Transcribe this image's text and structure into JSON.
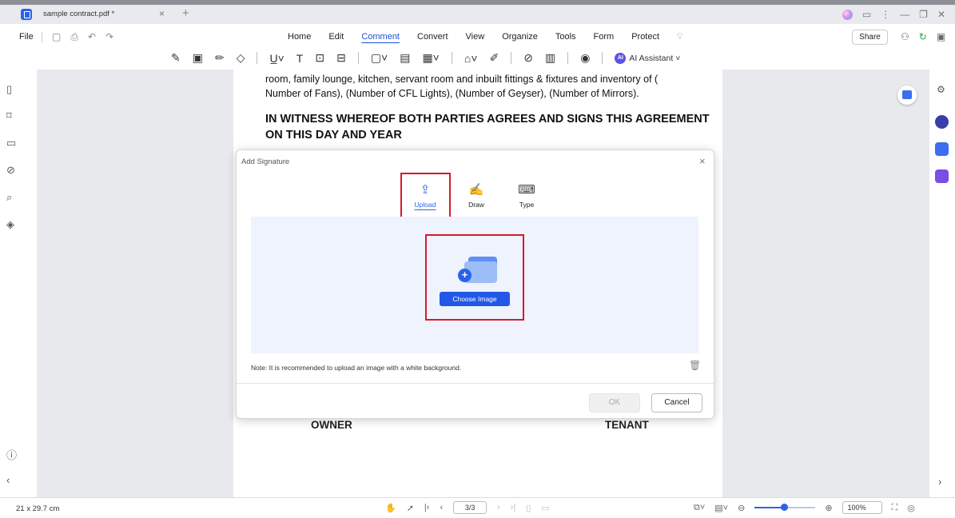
{
  "window": {
    "tab_title": "sample contract.pdf *",
    "tab_close": "×",
    "tab_add": "+",
    "controls": [
      "⋮",
      "—",
      "❐",
      "✕"
    ]
  },
  "menubar": {
    "file": "File",
    "menus": [
      "Home",
      "Edit",
      "Comment",
      "Convert",
      "View",
      "Organize",
      "Tools",
      "Form",
      "Protect"
    ],
    "active_menu": "Comment",
    "share": "Share"
  },
  "toolbar": {
    "ai_badge": "AI",
    "ai_assistant": "AI Assistant ˅"
  },
  "document": {
    "line1": "room, family lounge, kitchen, servant room and inbuilt fittings & fixtures and inventory of (",
    "line2": "Number of Fans), (Number of CFL Lights), (Number of Geyser), (Number of Mirrors).",
    "heading1": "IN WITNESS WHEREOF BOTH PARTIES AGREES AND SIGNS THIS AGREEMENT",
    "heading2": "ON THIS DAY AND YEAR",
    "owner": "OWNER",
    "tenant": "TENANT"
  },
  "dialog": {
    "title": "Add Signature",
    "close": "×",
    "tabs": [
      {
        "label": "Upload",
        "icon": "upload-icon"
      },
      {
        "label": "Draw",
        "icon": "draw-icon"
      },
      {
        "label": "Type",
        "icon": "keyboard-icon"
      }
    ],
    "active_tab": "Upload",
    "choose_image": "Choose Image",
    "note": "Note: It is recommended to upload an image with a white background.",
    "ok": "OK",
    "cancel": "Cancel"
  },
  "statusbar": {
    "page_size": "21 x 29.7 cm",
    "page_indicator": "3/3",
    "zoom": "100%",
    "zoom_level": 0.48
  },
  "colors": {
    "accent": "#2a63ea",
    "highlight": "#d8192a",
    "canvas": "#e8e9ec"
  }
}
